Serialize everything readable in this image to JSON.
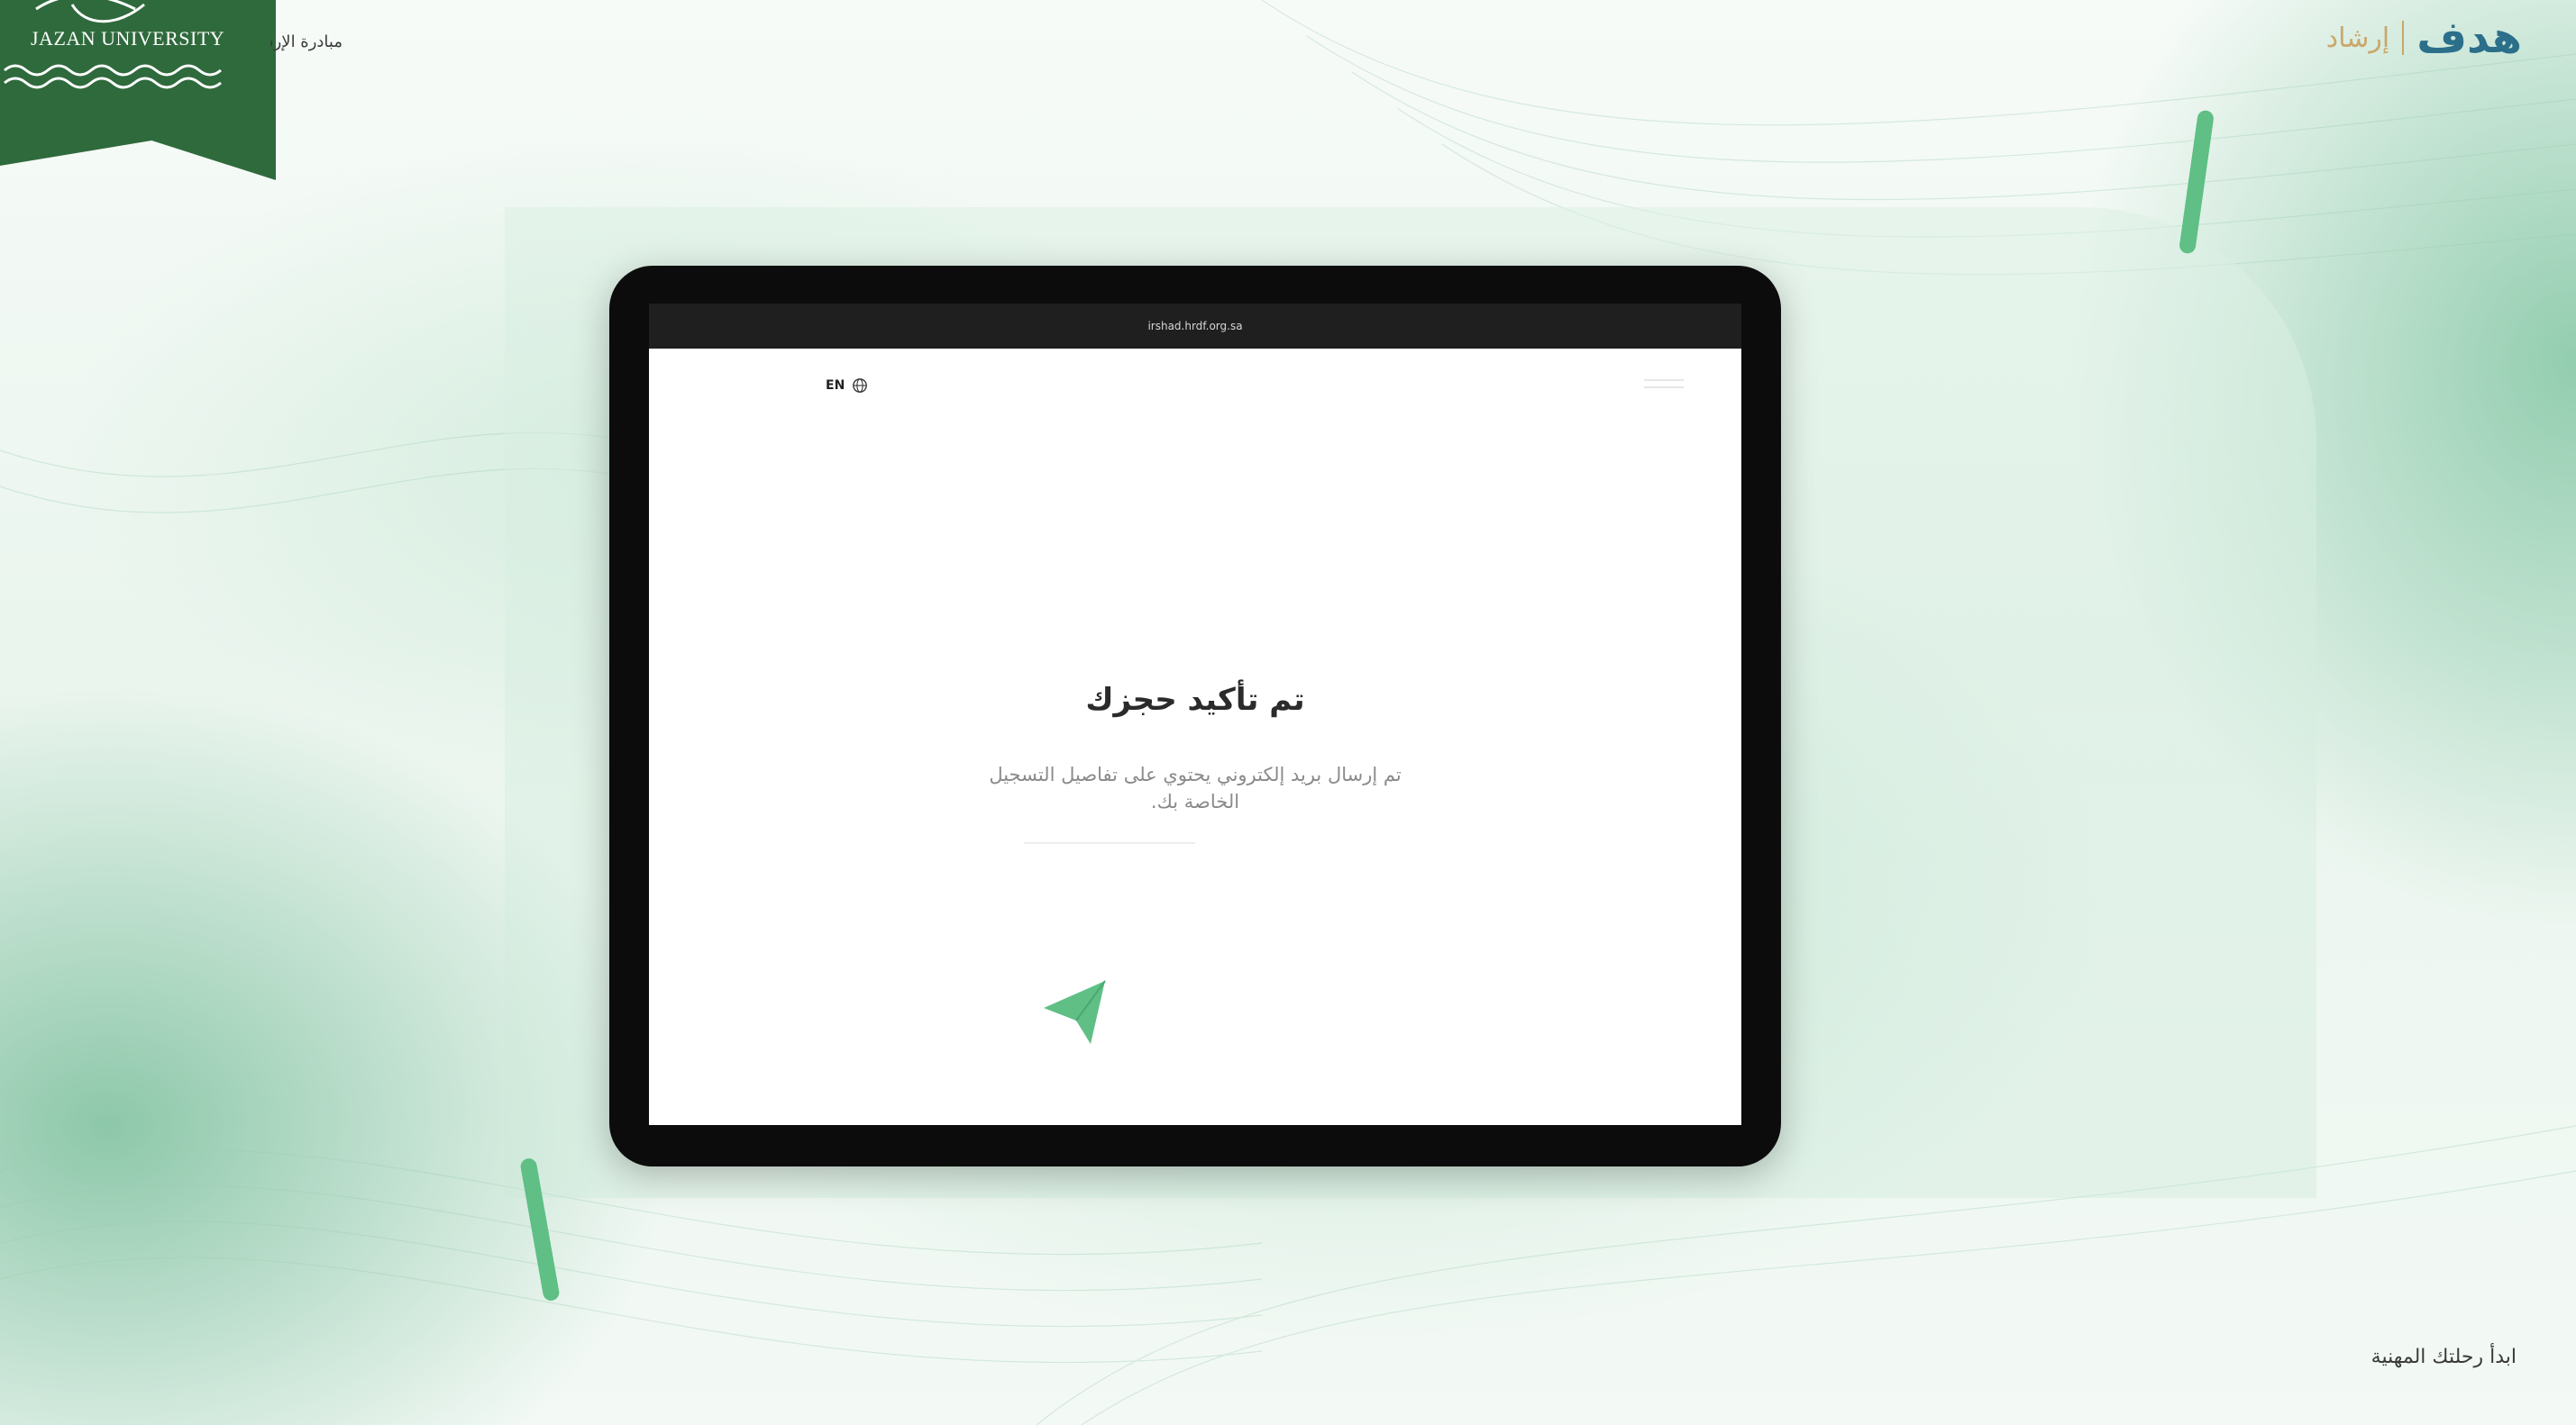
{
  "university": {
    "name": "JAZAN UNIVERSITY",
    "initiative_text": "مبادرة الإرشاد"
  },
  "brand": {
    "hadaf": "هدف",
    "irshad": "إرشاد",
    "colors": {
      "hadaf": "#2b6f8a",
      "irshad": "#c9a86a",
      "accent_green": "#5fbf85",
      "badge_green": "#2f6a3c"
    }
  },
  "browser": {
    "url": "irshad.hrdf.org.sa"
  },
  "page": {
    "language_toggle": "EN",
    "confirmation_title": "تم تأكيد حجزك",
    "confirmation_message": "تم إرسال بريد إلكتروني يحتوي على تفاصيل التسجيل الخاصة بك."
  },
  "footer": {
    "tagline": "ابدأ رحلتك المهنية"
  },
  "icons": {
    "globe": "globe-icon",
    "paper_plane": "paper-plane-icon",
    "menu": "menu-icon"
  }
}
